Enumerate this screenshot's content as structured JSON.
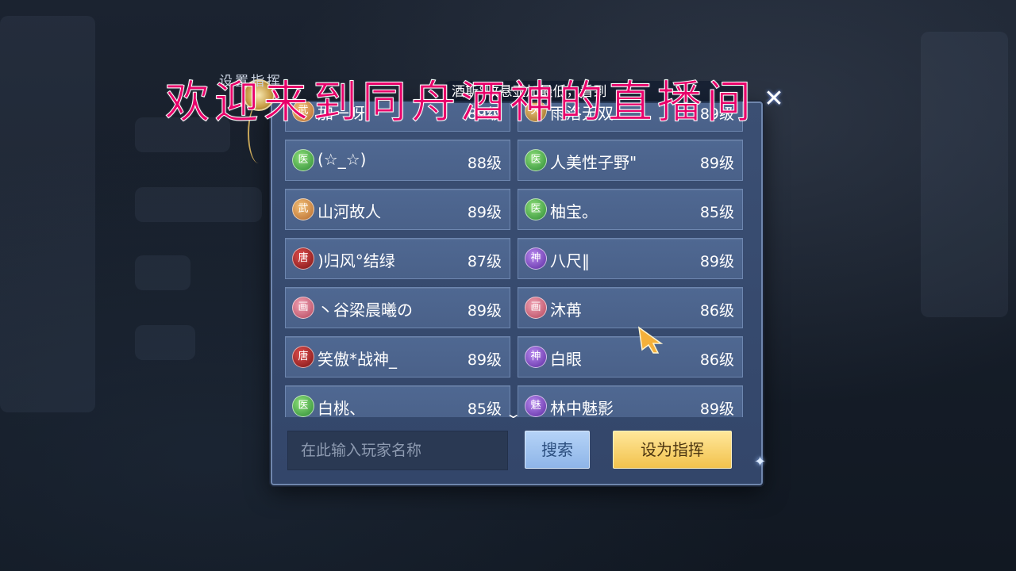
{
  "dialog": {
    "title": "设置指挥",
    "close_icon": "close-icon",
    "marquee": "酒斯°收悬壶加最低，看到"
  },
  "overlay_text": "欢迎来到同舟酒神的直播间",
  "players": [
    {
      "name": "加一呀",
      "level": "89级",
      "class_icon": "wudang",
      "glyph": "武"
    },
    {
      "name": "雨洛无双",
      "level": "89级",
      "class_icon": "tianxiang",
      "glyph": "天"
    },
    {
      "name": "(☆_☆)",
      "level": "88级",
      "class_icon": "yihua",
      "glyph": "医"
    },
    {
      "name": "人美性子野\"",
      "level": "89级",
      "class_icon": "yihua",
      "glyph": "医"
    },
    {
      "name": "山河故人",
      "level": "89级",
      "class_icon": "wudang",
      "glyph": "武"
    },
    {
      "name": "柚宝。",
      "level": "85级",
      "class_icon": "yihua",
      "glyph": "医"
    },
    {
      "name": ")归风°结绿",
      "level": "87级",
      "class_icon": "tangmen",
      "glyph": "唐"
    },
    {
      "name": "八尺‖",
      "level": "89级",
      "class_icon": "shenwei",
      "glyph": "神"
    },
    {
      "name": "丶谷梁晨曦の",
      "level": "89级",
      "class_icon": "huaying",
      "glyph": "画"
    },
    {
      "name": "沐苒",
      "level": "86级",
      "class_icon": "huaying",
      "glyph": "画"
    },
    {
      "name": "笑傲*战神_",
      "level": "89级",
      "class_icon": "tangmen",
      "glyph": "唐"
    },
    {
      "name": "白眼",
      "level": "86级",
      "class_icon": "shenwei",
      "glyph": "神"
    },
    {
      "name": "白桃、",
      "level": "85级",
      "class_icon": "yihua",
      "glyph": "医"
    },
    {
      "name": "林中魅影",
      "level": "89级",
      "class_icon": "shenwei",
      "glyph": "魅"
    }
  ],
  "search": {
    "placeholder": "在此输入玩家名称",
    "button_label": "搜索"
  },
  "set_commander_label": "设为指挥",
  "colors": {
    "panel": "#3b4f73",
    "card": "#4f6892",
    "confirm": "#f2c24d",
    "search_button": "#8eb5e8",
    "overlay_text": "#e8006a"
  }
}
